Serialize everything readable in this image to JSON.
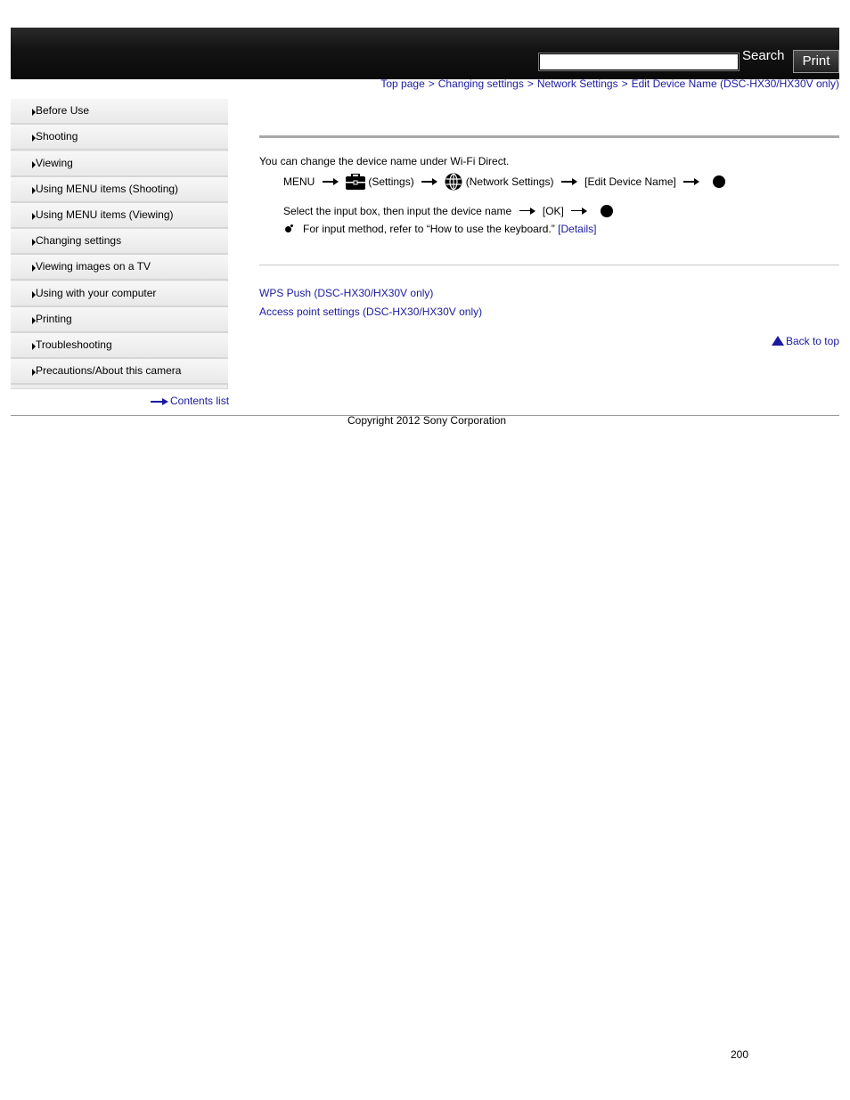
{
  "header": {
    "search_label": "Search",
    "print_label": "Print",
    "search_value": ""
  },
  "breadcrumb": {
    "items": [
      "Top page",
      "Changing settings",
      "Network Settings",
      "Edit Device Name (DSC-HX30/HX30V only)"
    ],
    "separator": ">"
  },
  "sidebar": {
    "items": [
      {
        "label": "Before Use"
      },
      {
        "label": "Shooting"
      },
      {
        "label": "Viewing"
      },
      {
        "label": "Using MENU items (Shooting)"
      },
      {
        "label": "Using MENU items (Viewing)"
      },
      {
        "label": "Changing settings"
      },
      {
        "label": "Viewing images on a TV"
      },
      {
        "label": "Using with your computer"
      },
      {
        "label": "Printing"
      },
      {
        "label": "Troubleshooting"
      },
      {
        "label": "Precautions/About this camera"
      }
    ],
    "contents_link": "Contents list"
  },
  "main": {
    "intro": "You can change the device name under Wi-Fi Direct.",
    "step1": {
      "menu": "MENU",
      "settings": "(Settings)",
      "network_settings": "(Network Settings)",
      "edit_device_name": "[Edit Device Name]",
      "settings_icon": "toolbox-icon",
      "network_icon": "globe-icon",
      "center_button_icon": "center-button-icon"
    },
    "step2": {
      "text": "Select the input box, then input the device name",
      "ok": "[OK]"
    },
    "note": {
      "text": "For input method, refer to “How to use the keyboard.”",
      "details_link": "[Details]"
    },
    "related_links": [
      "WPS Push (DSC-HX30/HX30V only)",
      "Access point settings (DSC-HX30/HX30V only)"
    ],
    "back_to_top": "Back to top"
  },
  "footer": {
    "copyright": "Copyright 2012 Sony Corporation",
    "page_number": "200"
  },
  "colors": {
    "link": "#1a1a9e",
    "header_bg": "#141414"
  }
}
